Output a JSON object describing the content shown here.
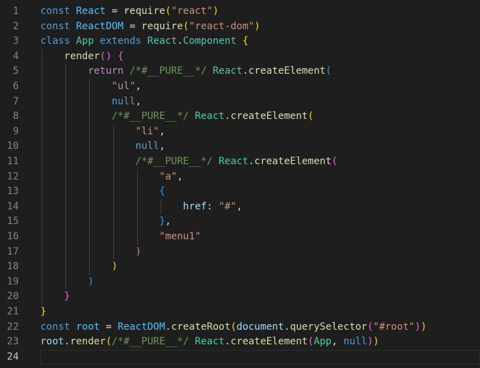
{
  "editor": {
    "colors": {
      "background": "#1e1e1e",
      "line_number": "#858585",
      "line_number_active": "#c6c6c6",
      "keyword": "#569cd6",
      "control": "#c586c0",
      "variable": "#9cdcfe",
      "constant": "#4fc1ff",
      "class": "#4ec9b0",
      "function": "#dcdcaa",
      "string": "#ce9178",
      "comment": "#6a9955",
      "punctuation": "#d4d4d4",
      "bracket1": "#ffd700",
      "bracket2": "#da70d6",
      "bracket3": "#179fff"
    },
    "active_line": 24,
    "lines": [
      [
        {
          "t": "const",
          "c": "keyword"
        },
        {
          "t": " ",
          "c": "punctuation"
        },
        {
          "t": "React",
          "c": "constant"
        },
        {
          "t": " = ",
          "c": "punctuation"
        },
        {
          "t": "require",
          "c": "function"
        },
        {
          "t": "(",
          "c": "bracket1"
        },
        {
          "t": "\"react\"",
          "c": "string"
        },
        {
          "t": ")",
          "c": "bracket1"
        }
      ],
      [
        {
          "t": "const",
          "c": "keyword"
        },
        {
          "t": " ",
          "c": "punctuation"
        },
        {
          "t": "ReactDOM",
          "c": "constant"
        },
        {
          "t": " = ",
          "c": "punctuation"
        },
        {
          "t": "require",
          "c": "function"
        },
        {
          "t": "(",
          "c": "bracket1"
        },
        {
          "t": "\"react-dom\"",
          "c": "string"
        },
        {
          "t": ")",
          "c": "bracket1"
        }
      ],
      [
        {
          "t": "class",
          "c": "keyword"
        },
        {
          "t": " ",
          "c": "punctuation"
        },
        {
          "t": "App",
          "c": "class"
        },
        {
          "t": " ",
          "c": "punctuation"
        },
        {
          "t": "extends",
          "c": "keyword"
        },
        {
          "t": " ",
          "c": "punctuation"
        },
        {
          "t": "React",
          "c": "class"
        },
        {
          "t": ".",
          "c": "punctuation"
        },
        {
          "t": "Component",
          "c": "class"
        },
        {
          "t": " ",
          "c": "punctuation"
        },
        {
          "t": "{",
          "c": "bracket1"
        }
      ],
      [
        {
          "t": "    ",
          "c": "punctuation"
        },
        {
          "t": "render",
          "c": "function"
        },
        {
          "t": "()",
          "c": "bracket2"
        },
        {
          "t": " ",
          "c": "punctuation"
        },
        {
          "t": "{",
          "c": "bracket2"
        }
      ],
      [
        {
          "t": "        ",
          "c": "punctuation"
        },
        {
          "t": "return",
          "c": "control"
        },
        {
          "t": " ",
          "c": "punctuation"
        },
        {
          "t": "/*#__PURE__*/",
          "c": "comment"
        },
        {
          "t": " ",
          "c": "punctuation"
        },
        {
          "t": "React",
          "c": "class"
        },
        {
          "t": ".",
          "c": "punctuation"
        },
        {
          "t": "createElement",
          "c": "function"
        },
        {
          "t": "(",
          "c": "bracket3"
        }
      ],
      [
        {
          "t": "            ",
          "c": "punctuation"
        },
        {
          "t": "\"ul\"",
          "c": "string"
        },
        {
          "t": ",",
          "c": "punctuation"
        }
      ],
      [
        {
          "t": "            ",
          "c": "punctuation"
        },
        {
          "t": "null",
          "c": "keyword"
        },
        {
          "t": ",",
          "c": "punctuation"
        }
      ],
      [
        {
          "t": "            ",
          "c": "punctuation"
        },
        {
          "t": "/*#__PURE__*/",
          "c": "comment"
        },
        {
          "t": " ",
          "c": "punctuation"
        },
        {
          "t": "React",
          "c": "class"
        },
        {
          "t": ".",
          "c": "punctuation"
        },
        {
          "t": "createElement",
          "c": "function"
        },
        {
          "t": "(",
          "c": "bracket1"
        }
      ],
      [
        {
          "t": "                ",
          "c": "punctuation"
        },
        {
          "t": "\"li\"",
          "c": "string"
        },
        {
          "t": ",",
          "c": "punctuation"
        }
      ],
      [
        {
          "t": "                ",
          "c": "punctuation"
        },
        {
          "t": "null",
          "c": "keyword"
        },
        {
          "t": ",",
          "c": "punctuation"
        }
      ],
      [
        {
          "t": "                ",
          "c": "punctuation"
        },
        {
          "t": "/*#__PURE__*/",
          "c": "comment"
        },
        {
          "t": " ",
          "c": "punctuation"
        },
        {
          "t": "React",
          "c": "class"
        },
        {
          "t": ".",
          "c": "punctuation"
        },
        {
          "t": "createElement",
          "c": "function"
        },
        {
          "t": "(",
          "c": "bracket2"
        }
      ],
      [
        {
          "t": "                    ",
          "c": "punctuation"
        },
        {
          "t": "\"a\"",
          "c": "string"
        },
        {
          "t": ",",
          "c": "punctuation"
        }
      ],
      [
        {
          "t": "                    ",
          "c": "punctuation"
        },
        {
          "t": "{",
          "c": "bracket3"
        }
      ],
      [
        {
          "t": "                        ",
          "c": "punctuation"
        },
        {
          "t": "href",
          "c": "variable"
        },
        {
          "t": ": ",
          "c": "punctuation"
        },
        {
          "t": "\"#\"",
          "c": "string"
        },
        {
          "t": ",",
          "c": "punctuation"
        }
      ],
      [
        {
          "t": "                    ",
          "c": "punctuation"
        },
        {
          "t": "}",
          "c": "bracket3"
        },
        {
          "t": ",",
          "c": "punctuation"
        }
      ],
      [
        {
          "t": "                    ",
          "c": "punctuation"
        },
        {
          "t": "\"menu1\"",
          "c": "string"
        }
      ],
      [
        {
          "t": "                ",
          "c": "punctuation"
        },
        {
          "t": ")",
          "c": "bracket2"
        }
      ],
      [
        {
          "t": "            ",
          "c": "punctuation"
        },
        {
          "t": ")",
          "c": "bracket1"
        }
      ],
      [
        {
          "t": "        ",
          "c": "punctuation"
        },
        {
          "t": ")",
          "c": "bracket3"
        }
      ],
      [
        {
          "t": "    ",
          "c": "punctuation"
        },
        {
          "t": "}",
          "c": "bracket2"
        }
      ],
      [
        {
          "t": "}",
          "c": "bracket1"
        }
      ],
      [
        {
          "t": "const",
          "c": "keyword"
        },
        {
          "t": " ",
          "c": "punctuation"
        },
        {
          "t": "root",
          "c": "constant"
        },
        {
          "t": " = ",
          "c": "punctuation"
        },
        {
          "t": "ReactDOM",
          "c": "constant"
        },
        {
          "t": ".",
          "c": "punctuation"
        },
        {
          "t": "createRoot",
          "c": "function"
        },
        {
          "t": "(",
          "c": "bracket1"
        },
        {
          "t": "document",
          "c": "variable"
        },
        {
          "t": ".",
          "c": "punctuation"
        },
        {
          "t": "querySelector",
          "c": "function"
        },
        {
          "t": "(",
          "c": "bracket2"
        },
        {
          "t": "\"#root\"",
          "c": "string"
        },
        {
          "t": ")",
          "c": "bracket2"
        },
        {
          "t": ")",
          "c": "bracket1"
        }
      ],
      [
        {
          "t": "root",
          "c": "variable"
        },
        {
          "t": ".",
          "c": "punctuation"
        },
        {
          "t": "render",
          "c": "function"
        },
        {
          "t": "(",
          "c": "bracket1"
        },
        {
          "t": "/*#__PURE__*/",
          "c": "comment"
        },
        {
          "t": " ",
          "c": "punctuation"
        },
        {
          "t": "React",
          "c": "class"
        },
        {
          "t": ".",
          "c": "punctuation"
        },
        {
          "t": "createElement",
          "c": "function"
        },
        {
          "t": "(",
          "c": "bracket2"
        },
        {
          "t": "App",
          "c": "class"
        },
        {
          "t": ", ",
          "c": "punctuation"
        },
        {
          "t": "null",
          "c": "keyword"
        },
        {
          "t": ")",
          "c": "bracket2"
        },
        {
          "t": ")",
          "c": "bracket1"
        }
      ],
      []
    ]
  }
}
